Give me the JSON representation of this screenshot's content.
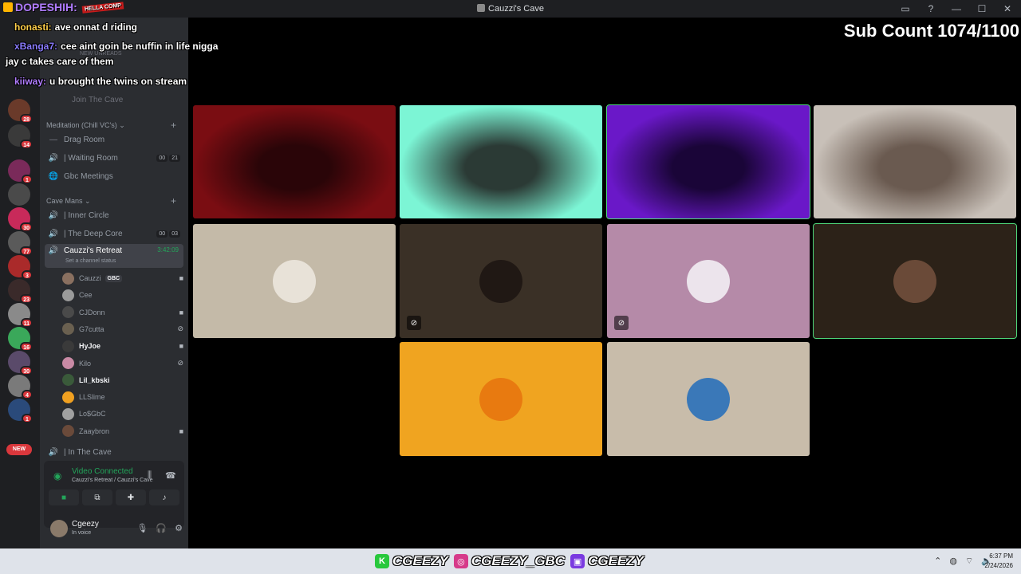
{
  "window": {
    "title": "Cauzzi's Cave"
  },
  "overlay": {
    "streamer_name": "DOPESHIH:",
    "streamer_logo": "HELLA COMP",
    "sub_count_label": "Sub Count 1074/1100",
    "chat": [
      {
        "user": "honasti:",
        "message": "ave onnat d riding",
        "color": "#ffcf4a"
      },
      {
        "user": "xBanga7:",
        "message": "cee aint goin be nuffin in life nigga",
        "color": "#8a7cff"
      },
      {
        "user": "",
        "message": "jay c takes care of them",
        "color": "#ffffff"
      },
      {
        "user": "kiiway:",
        "message": "u brought the twins on stream",
        "color": "#b07cff"
      }
    ]
  },
  "rail": {
    "badges": [
      "28",
      "14",
      "1",
      "30",
      "77",
      "3",
      "23",
      "11",
      "16",
      "30",
      "4",
      "1"
    ],
    "new_label": "NEW"
  },
  "sidebar": {
    "ghost_top": [
      "NEW UNREADS",
      "Join The Cave"
    ],
    "meditation": {
      "category": "Meditation (Chill VC's)",
      "channels": [
        {
          "icon": "—",
          "name": "Drag Room"
        },
        {
          "icon": "🔊",
          "name": "| Waiting Room",
          "counts": [
            "00",
            "21"
          ]
        },
        {
          "icon": "🌐",
          "name": "Gbc Meetings"
        }
      ]
    },
    "cave_mans": {
      "category": "Cave Mans",
      "channels": [
        {
          "icon": "🔊",
          "name": "| Inner Circle"
        },
        {
          "icon": "🔊",
          "name": "| The Deep Core",
          "counts": [
            "00",
            "03"
          ]
        }
      ],
      "active_channel": {
        "name": "Cauzzi's Retreat",
        "timer": "3:42:09",
        "status": "Set a channel status"
      },
      "members": [
        {
          "name": "Cauzzi",
          "tag": "GBC",
          "icon": "camera-icon",
          "color": "#8a7060",
          "bold": false
        },
        {
          "name": "Cee",
          "icon": "",
          "color": "#9a9a9a",
          "bold": false
        },
        {
          "name": "CJDonn",
          "icon": "camera-icon",
          "color": "#4a4a4a",
          "bold": false
        },
        {
          "name": "G7cutta",
          "icon": "muted-icon",
          "color": "#6a6050",
          "bold": false
        },
        {
          "name": "HyJoe",
          "icon": "camera-icon",
          "color": "#3a3a3a",
          "bold": true
        },
        {
          "name": "Kilo",
          "icon": "muted-icon",
          "color": "#c98aa5",
          "bold": false
        },
        {
          "name": "Lil_kbski",
          "icon": "",
          "color": "#3a5a3a",
          "bold": true
        },
        {
          "name": "LLSlime",
          "icon": "",
          "color": "#f0a020",
          "bold": false
        },
        {
          "name": "Lo$GbC",
          "icon": "",
          "color": "#a0a0a0",
          "bold": false
        },
        {
          "name": "Zaaybron",
          "icon": "camera-icon",
          "color": "#6a4a3a",
          "bold": false
        }
      ],
      "after_channel": {
        "icon": "🔊",
        "name": "| In The Cave"
      }
    },
    "voice": {
      "status": "Video Connected",
      "location": "Cauzzi's Retreat / Cauzzi's Cave"
    },
    "user": {
      "name": "Cgeezy",
      "status": "In voice"
    }
  },
  "video_tiles": [
    {
      "type": "video",
      "colors": [
        "#7a0d12",
        "#2a0508"
      ],
      "speaking": false
    },
    {
      "type": "video",
      "colors": [
        "#7cf5d5",
        "#2b3a35"
      ],
      "speaking": false
    },
    {
      "type": "video",
      "colors": [
        "#6a18c8",
        "#1a0538"
      ],
      "speaking": true
    },
    {
      "type": "video",
      "colors": [
        "#c8c0b8",
        "#6a5a50"
      ],
      "speaking": false
    },
    {
      "type": "avatar",
      "bg": "#c4baa8",
      "avatar": "#e8e2d8",
      "muted": false,
      "speaking": false
    },
    {
      "type": "avatar",
      "bg": "#3a3026",
      "avatar": "#201814",
      "muted": true,
      "speaking": false
    },
    {
      "type": "avatar",
      "bg": "#b58aa8",
      "avatar": "#ece4ec",
      "muted": true,
      "speaking": false
    },
    {
      "type": "avatar",
      "bg": "#2c2218",
      "avatar": "#6a4a38",
      "muted": false,
      "speaking": true
    },
    {
      "type": "avatar",
      "bg": "#f0a420",
      "avatar": "#e87a10",
      "muted": false,
      "speaking": false
    },
    {
      "type": "avatar",
      "bg": "#c8bcaa",
      "avatar": "#3a78b8",
      "muted": false,
      "speaking": false
    }
  ],
  "taskbar": {
    "socials": [
      {
        "platform": "kick",
        "handle": "CGEEZY",
        "color": "#28c83c"
      },
      {
        "platform": "instagram",
        "handle": "CGEEZY_GBC",
        "color": "#d63a8a"
      },
      {
        "platform": "twitch",
        "handle": "CGEEZY",
        "color": "#7a3ae0"
      }
    ],
    "time": "6:37 PM",
    "date": "2/24/2026"
  }
}
